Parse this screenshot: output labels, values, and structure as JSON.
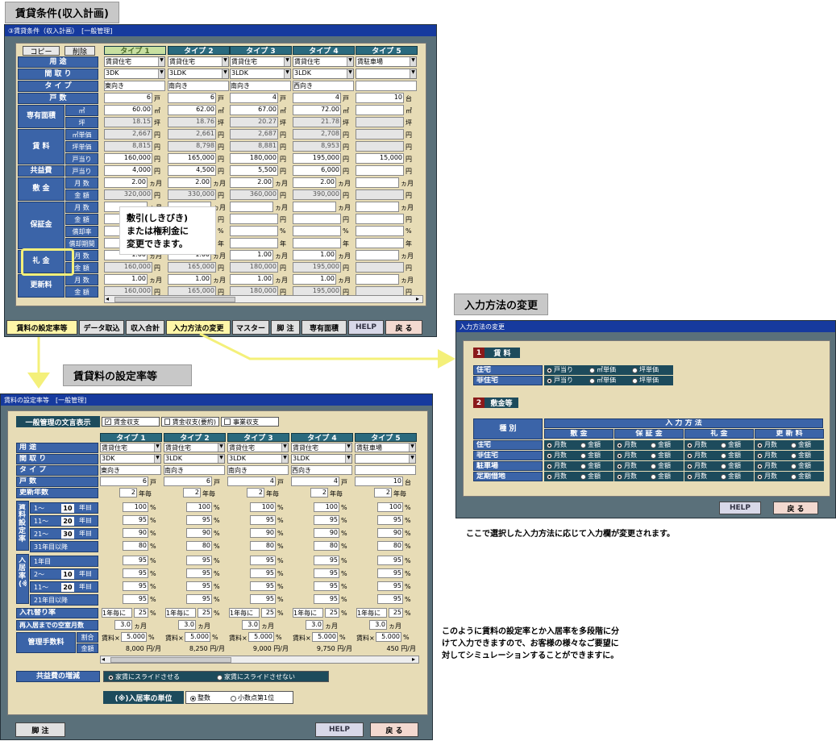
{
  "headings": {
    "main": "賃貸条件(収入計画)",
    "input_method": "入力方法の変更",
    "rate_setting": "賃貸料の設定率等"
  },
  "win1": {
    "title": "③賃貸条件（収入計画）　[一般管理]",
    "copy": "コピー",
    "delete": "削除",
    "types": [
      "タイプ 1",
      "タイプ 2",
      "タイプ 3",
      "タイプ 4",
      "タイプ 5"
    ],
    "row_labels": {
      "use": "用 途",
      "layout": "間 取 り",
      "type": "タ イ プ",
      "units": "戸 数",
      "area": "専有面積",
      "rent": "賃 料",
      "common": "共益費",
      "deposit": "敷 金",
      "guarantee": "保証金",
      "key": "礼 金",
      "renew": "更新料"
    },
    "sub_labels": {
      "m2": "㎡",
      "tsubo": "坪",
      "m2price": "㎡単価",
      "tsuboprice": "坪単価",
      "perunit": "戸当り",
      "months": "月 数",
      "amount": "金 額",
      "amortrate": "償却率",
      "amortperiod": "償却期間"
    },
    "use": [
      "賃貸住宅",
      "賃貸住宅",
      "賃貸住宅",
      "賃貸住宅",
      "賃駐車場"
    ],
    "layout": [
      "3DK",
      "3LDK",
      "3LDK",
      "3LDK",
      ""
    ],
    "typename": [
      "東向き",
      "南向き",
      "南向き",
      "西向き",
      ""
    ],
    "units": [
      "6",
      "6",
      "4",
      "4",
      "10"
    ],
    "units_unit": [
      "戸",
      "戸",
      "戸",
      "戸",
      "台"
    ],
    "area_m2": [
      "60.00",
      "62.00",
      "67.00",
      "72.00",
      ""
    ],
    "area_tsubo": [
      "18.15",
      "18.76",
      "20.27",
      "21.78",
      ""
    ],
    "rent_m2": [
      "2,667",
      "2,661",
      "2,687",
      "2,708",
      ""
    ],
    "rent_tsubo": [
      "8,815",
      "8,798",
      "8,881",
      "8,953",
      ""
    ],
    "rent_unit": [
      "160,000",
      "165,000",
      "180,000",
      "195,000",
      "15,000"
    ],
    "common": [
      "4,000",
      "4,500",
      "5,500",
      "6,000",
      ""
    ],
    "dep_months": [
      "2.00",
      "2.00",
      "2.00",
      "2.00",
      ""
    ],
    "dep_amount": [
      "320,000",
      "330,000",
      "360,000",
      "390,000",
      ""
    ],
    "key_months": [
      "1.00",
      "1.00",
      "1.00",
      "1.00",
      ""
    ],
    "key_amount": [
      "160,000",
      "165,000",
      "180,000",
      "195,000",
      ""
    ],
    "ren_months": [
      "1.00",
      "1.00",
      "1.00",
      "1.00",
      ""
    ],
    "ren_amount": [
      "160,000",
      "165,000",
      "180,000",
      "195,000",
      ""
    ],
    "units_yen": "円",
    "units_month": "ヵ月",
    "units_pct": "%",
    "units_year": "年",
    "units_m2": "㎡",
    "units_tsubo": "坪",
    "units_ka": "ヵ",
    "callout": "敷引(しきびき)\nまたは権利金に\n変更できます。",
    "toolbar": [
      "賃料の設定率等",
      "データ取込",
      "収入合計",
      "入力方法の変更",
      "マスター",
      "脚 注",
      "専有面積",
      "HELP",
      "戻 る"
    ]
  },
  "win2": {
    "title": "入力方法の変更",
    "sec1_num": "1",
    "sec1_label": "賃 料",
    "sec1_rows": [
      "住宅",
      "非住宅"
    ],
    "sec1_opts": [
      "戸当り",
      "㎡単価",
      "坪単価"
    ],
    "sec2_num": "2",
    "sec2_label": "敷金等",
    "kind": "種 別",
    "method": "入 力 方 法",
    "cols": [
      "敷 金",
      "保 証 金",
      "礼 金",
      "更 新 料"
    ],
    "rows": [
      "住宅",
      "非住宅",
      "駐車場",
      "定期借地"
    ],
    "opts": [
      "月数",
      "金額"
    ],
    "help": "HELP",
    "back": "戻 る"
  },
  "note1": "ここで選択した入力方法に応じて入力欄が変更されます。",
  "note2": "このように賃料の設定率とか入居率を多段階に分\nけて入力できますので、お客様の様々なご要望に\n対してシミュレーションすることができますに。",
  "win3": {
    "title": "賃料の設定率等　[一般管理]",
    "display_label": "一般管理の文言表示",
    "checks": [
      "賃金収支",
      "賃金収支(要約)",
      "事業収支"
    ],
    "types": [
      "タイプ 1",
      "タイプ 2",
      "タイプ 3",
      "タイプ 4",
      "タイプ 5"
    ],
    "row_use": "用 途",
    "row_layout": "間 取 り",
    "row_type": "タ イ プ",
    "row_units": "戸 数",
    "row_renew": "更新年数",
    "use": [
      "賃貸住宅",
      "賃貸住宅",
      "賃貸住宅",
      "賃貸住宅",
      "賃駐車場"
    ],
    "layout": [
      "3DK",
      "3LDK",
      "3LDK",
      "3LDK",
      ""
    ],
    "typename": [
      "東向き",
      "南向き",
      "南向き",
      "西向き",
      ""
    ],
    "units": [
      "6",
      "6",
      "4",
      "4",
      "10"
    ],
    "units_unit": [
      "戸",
      "戸",
      "戸",
      "戸",
      "台"
    ],
    "renew": "2",
    "renew_unit": "年毎",
    "rent_rate_label": "賃料設定率",
    "rent_rate_rows": [
      [
        "1～",
        "10",
        "年目"
      ],
      [
        "11～",
        "20",
        "年目"
      ],
      [
        "21～",
        "30",
        "年目"
      ],
      [
        "31年目以降",
        "",
        ""
      ]
    ],
    "rent_rate_vals": [
      [
        "100",
        "100",
        "100",
        "100",
        "100"
      ],
      [
        "95",
        "95",
        "95",
        "95",
        "95"
      ],
      [
        "90",
        "90",
        "90",
        "90",
        "90"
      ],
      [
        "80",
        "80",
        "80",
        "80",
        "80"
      ]
    ],
    "occ_label": "入居率(※)",
    "occ_rows": [
      [
        "1年目",
        "",
        ""
      ],
      [
        "2～",
        "10",
        "年目"
      ],
      [
        "11～",
        "20",
        "年目"
      ],
      [
        "21年目以降",
        "",
        ""
      ]
    ],
    "occ_vals": [
      [
        "95",
        "95",
        "95",
        "95",
        "95"
      ],
      [
        "95",
        "95",
        "95",
        "95",
        "95"
      ],
      [
        "95",
        "95",
        "95",
        "95",
        "95"
      ],
      [
        "95",
        "95",
        "95",
        "95",
        "95"
      ]
    ],
    "turnover_label": "入れ替り率",
    "turnover_prefix": "1年毎に",
    "turnover": "25",
    "vacancy_label": "再入居までの空室月数",
    "vacancy": "3.0",
    "vacancy_unit": "ヵ月",
    "fee_label": "管理手数料",
    "fee_sub1": "割合",
    "fee_sub2": "金額",
    "fee_prefix": "賃料×",
    "fee_rate": "5.000",
    "fee_amount": [
      "8,000",
      "8,250",
      "9,000",
      "9,750",
      "450"
    ],
    "fee_unit": "円/月",
    "common_label": "共益費の増減",
    "common_opts": [
      "家賃にスライドさせる",
      "家賃にスライドさせない"
    ],
    "occ_unit_label": "(※)入居率の単位",
    "occ_unit_opts": [
      "整数",
      "小数点第1位"
    ],
    "footnote": "脚 注",
    "help": "HELP",
    "back": "戻 る"
  }
}
